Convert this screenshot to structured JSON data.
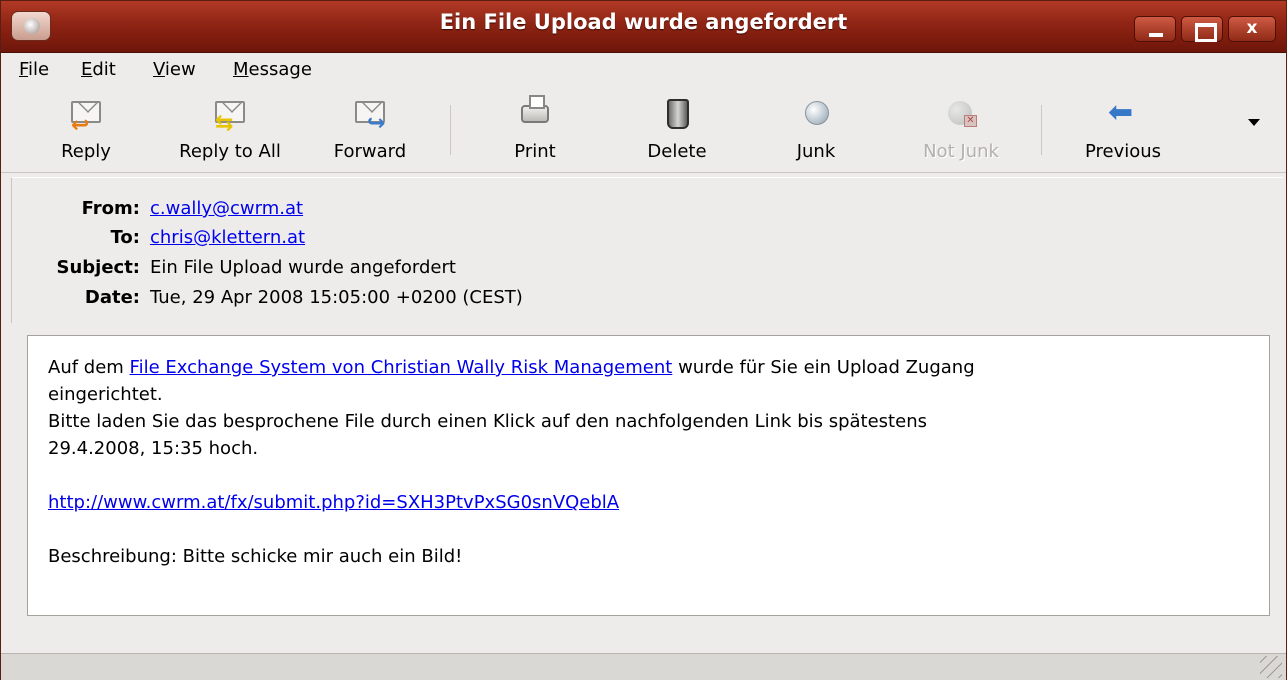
{
  "window": {
    "title": "Ein File Upload wurde angefordert",
    "close_glyph": "x"
  },
  "menubar": {
    "items": [
      {
        "mnemonic": "F",
        "rest": "ile"
      },
      {
        "mnemonic": "E",
        "rest": "dit"
      },
      {
        "mnemonic": "V",
        "rest": "iew"
      },
      {
        "mnemonic": "M",
        "rest": "essage"
      }
    ]
  },
  "toolbar": {
    "reply": "Reply",
    "reply_all": "Reply to All",
    "forward": "Forward",
    "print": "Print",
    "delete": "Delete",
    "junk": "Junk",
    "not_junk": "Not Junk",
    "previous": "Previous"
  },
  "headers": {
    "from_label": "From:",
    "from_value": "c.wally@cwrm.at",
    "to_label": "To:",
    "to_value": "chris@klettern.at",
    "subject_label": "Subject:",
    "subject_value": "Ein File Upload wurde angefordert",
    "date_label": "Date:",
    "date_value": "Tue, 29 Apr 2008 15:05:00 +0200 (CEST)"
  },
  "body": {
    "line1_prefix": "Auf dem ",
    "line1_link": "File Exchange System von Christian Wally Risk Management",
    "line1_suffix": " wurde für Sie ein Upload Zugang",
    "line2": "eingerichtet.",
    "line3": "Bitte laden Sie das besprochene File durch einen Klick auf den nachfolgenden Link bis spätestens",
    "line4": "29.4.2008, 15:35 hoch.",
    "upload_link": "http://www.cwrm.at/fx/submit.php?id=SXH3PtvPxSG0snVQeblA",
    "description": "Beschreibung: Bitte schicke mir auch ein Bild!"
  },
  "colors": {
    "titlebar": "#8f2414",
    "link": "#0000ee",
    "background": "#edeceb"
  }
}
